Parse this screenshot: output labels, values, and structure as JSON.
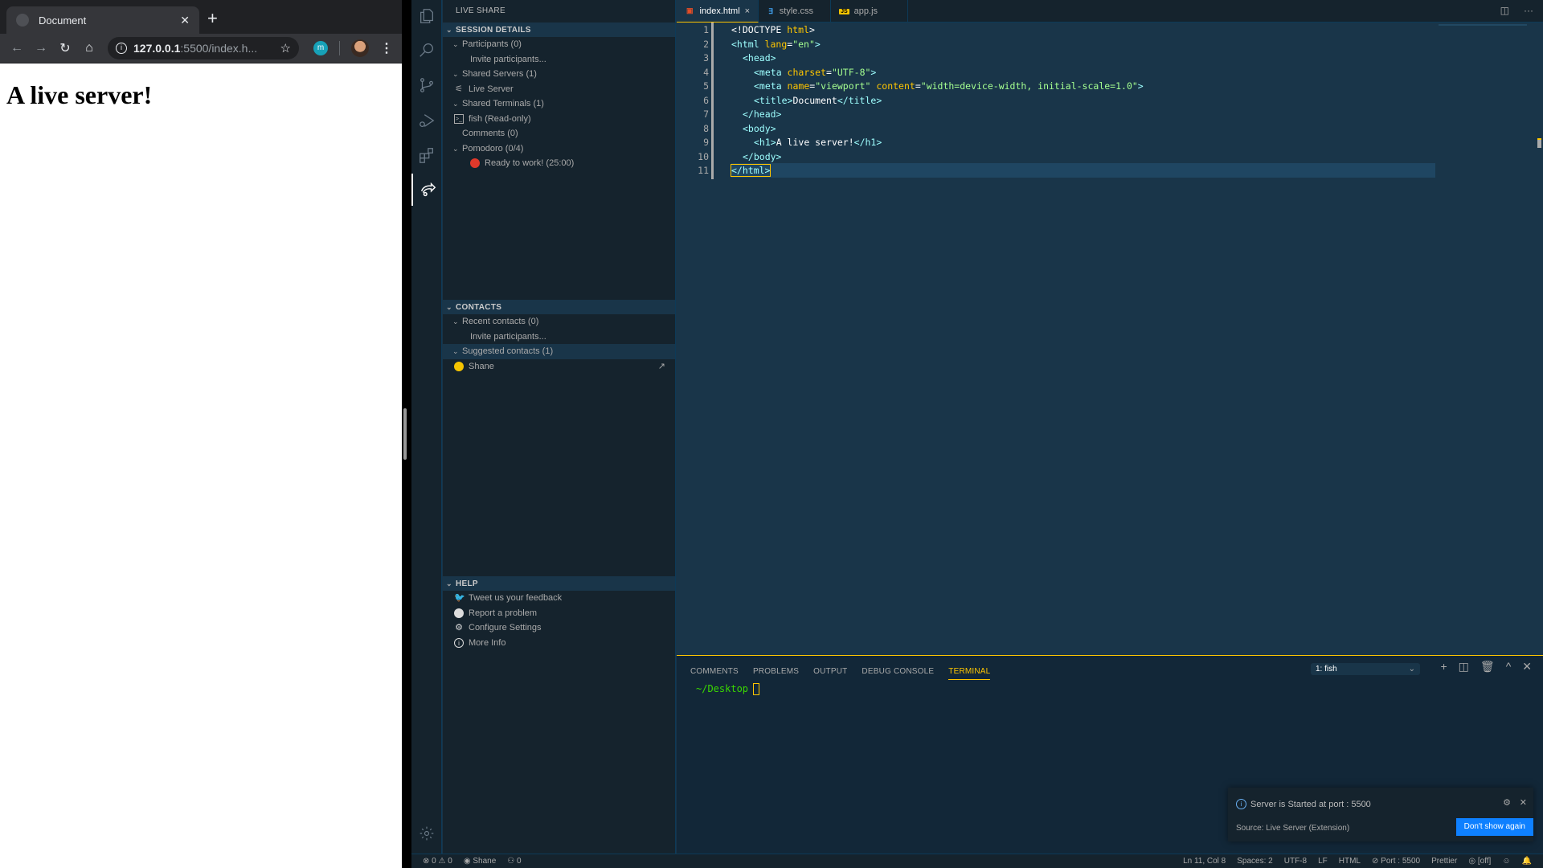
{
  "browser": {
    "tab_title": "Document",
    "url_host": "127.0.0.1",
    "url_rest": ":5500/index.h...",
    "extension_label": "m",
    "page_heading": "A live server!"
  },
  "sidebar": {
    "title": "LIVE SHARE",
    "session": {
      "header": "SESSION DETAILS",
      "items": [
        {
          "label": "Participants (0)"
        },
        {
          "label": "Invite participants..."
        },
        {
          "label": "Shared Servers (1)"
        },
        {
          "label": "Live Server"
        },
        {
          "label": "Shared Terminals (1)"
        },
        {
          "label": "fish (Read-only)"
        },
        {
          "label": "Comments (0)"
        },
        {
          "label": "Pomodoro (0/4)"
        },
        {
          "label": "Ready to work! (25:00)"
        }
      ]
    },
    "contacts": {
      "header": "CONTACTS",
      "items": [
        {
          "label": "Recent contacts (0)"
        },
        {
          "label": "Invite participants..."
        },
        {
          "label": "Suggested contacts (1)"
        },
        {
          "label": "Shane"
        }
      ]
    },
    "help": {
      "header": "HELP",
      "items": [
        {
          "label": "Tweet us your feedback"
        },
        {
          "label": "Report a problem"
        },
        {
          "label": "Configure Settings"
        },
        {
          "label": "More Info"
        }
      ]
    }
  },
  "editor": {
    "tabs": [
      {
        "label": "index.html",
        "icon": "5"
      },
      {
        "label": "style.css",
        "icon": "3"
      },
      {
        "label": "app.js",
        "icon": "JS"
      }
    ],
    "line_numbers": [
      "1",
      "2",
      "3",
      "4",
      "5",
      "6",
      "7",
      "8",
      "9",
      "10",
      "11"
    ],
    "code": {
      "l1a": "<!DOCTYPE ",
      "l1b": "html",
      "l1c": ">",
      "l2a": "<html ",
      "l2b": "lang",
      "l2c": "=",
      "l2d": "\"en\"",
      "l2e": ">",
      "l3": "<head>",
      "l4a": "<meta ",
      "l4b": "charset",
      "l4c": "=",
      "l4d": "\"UTF-8\"",
      "l4e": ">",
      "l5a": "<meta ",
      "l5b": "name",
      "l5c": "=",
      "l5d": "\"viewport\"",
      "l5e": " content",
      "l5f": "=",
      "l5g": "\"width=device-width, initial-scale=1.0\"",
      "l5h": ">",
      "l6a": "<title>",
      "l6b": "Document",
      "l6c": "</title>",
      "l7": "</head>",
      "l8": "<body>",
      "l9a": "<h1>",
      "l9b": "A live server!",
      "l9c": "</h1>",
      "l10": "</body>",
      "l11": "</html>"
    }
  },
  "panel": {
    "tabs": [
      "COMMENTS",
      "PROBLEMS",
      "OUTPUT",
      "DEBUG CONSOLE",
      "TERMINAL"
    ],
    "active_tab": "TERMINAL",
    "terminal_select": "1: fish",
    "prompt": "~/Desktop"
  },
  "notification": {
    "message": "Server is Started at port : 5500",
    "source": "Source: Live Server (Extension)",
    "button": "Don't show again"
  },
  "status": {
    "errors": "0",
    "warnings": "0",
    "user": "Shane",
    "participants": "0",
    "position": "Ln 11, Col 8",
    "spaces": "Spaces: 2",
    "encoding": "UTF-8",
    "eol": "LF",
    "language": "HTML",
    "port": "Port : 5500",
    "formatter": "Prettier",
    "live": "[off]"
  },
  "colors": {
    "accent": "#ffc600",
    "editor_bg": "#193549",
    "sidebar_bg": "#15232d",
    "button_blue": "#0e80ff"
  }
}
